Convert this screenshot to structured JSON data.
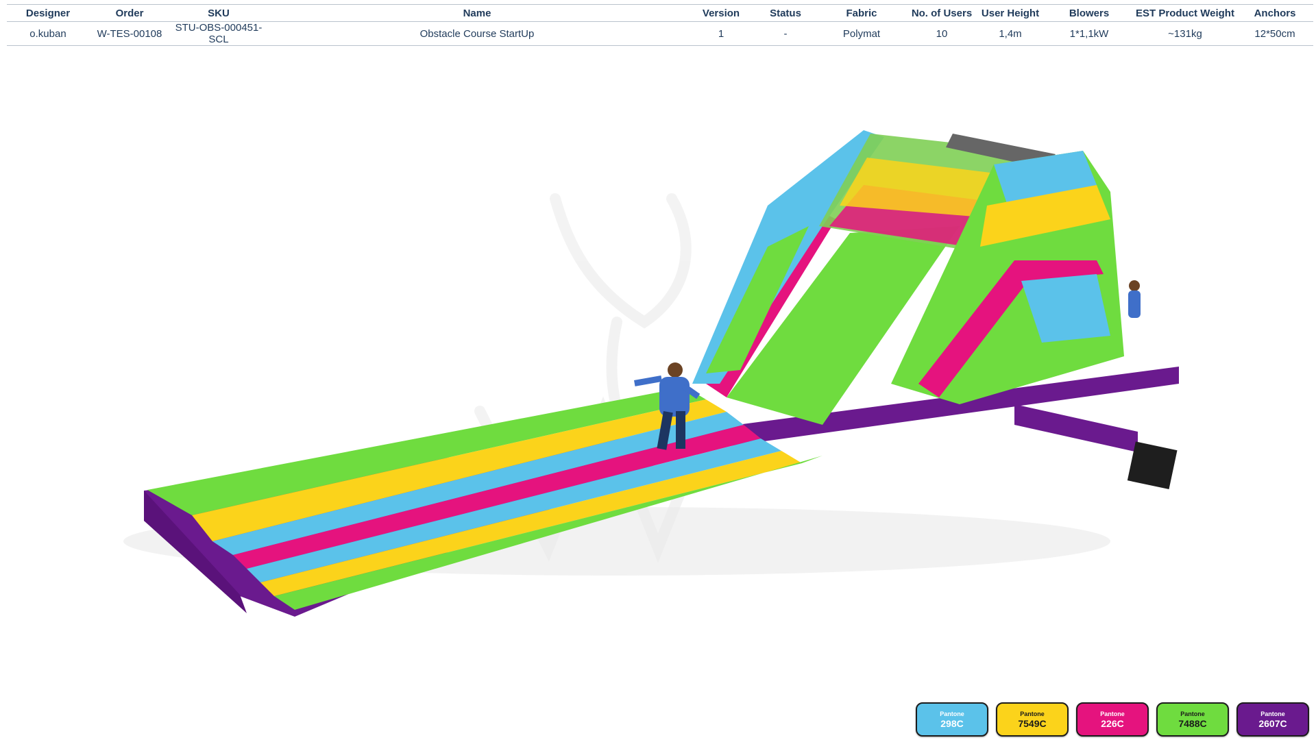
{
  "spec_table": {
    "headers": [
      "Designer",
      "Order",
      "SKU",
      "Name",
      "Version",
      "Status",
      "Fabric",
      "No. of Users",
      "User  Height",
      "Blowers",
      "EST Product Weight",
      "Anchors"
    ],
    "values": [
      "o.kuban",
      "W-TES-00108",
      "STU-OBS-000451-SCL",
      "Obstacle Course StartUp",
      "1",
      "-",
      "Polymat",
      "10",
      "1,4m",
      "1*1,1kW",
      "~131kg",
      "12*50cm"
    ]
  },
  "palette": [
    {
      "label": "Pantone",
      "code": "298C",
      "color": "#5bc2ea"
    },
    {
      "label": "Pantone",
      "code": "7549C",
      "color": "#fbd31b"
    },
    {
      "label": "Pantone",
      "code": "226C",
      "color": "#e5137e"
    },
    {
      "label": "Pantone",
      "code": "7488C",
      "color": "#6fdc3f"
    },
    {
      "label": "Pantone",
      "code": "2607C",
      "color": "#6a1a8e"
    }
  ]
}
